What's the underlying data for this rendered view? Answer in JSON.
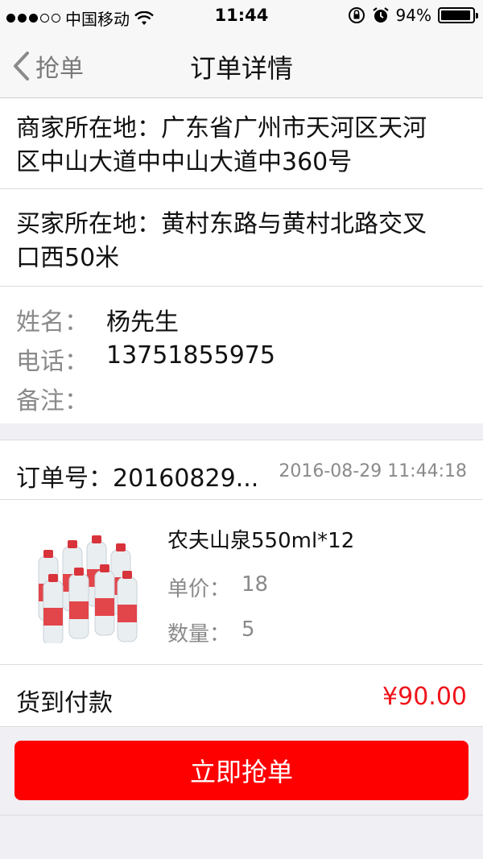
{
  "status_bar": {
    "carrier": "中国移动",
    "time": "11:44",
    "battery": "94%",
    "battery_level": 0.94
  },
  "nav": {
    "back_label": "抢单",
    "title": "订单详情"
  },
  "merchant": {
    "line1": "商家所在地：广东省广州市天河区天河",
    "line2": "区中山大道中中山大道中360号"
  },
  "buyer": {
    "line1": "买家所在地：黄村东路与黄村北路交叉",
    "line2": "口西50米"
  },
  "contact": {
    "name_label": "姓名：",
    "name_value": "杨先生",
    "phone_label": "电话：",
    "phone_value": "13751855975",
    "note_label": "备注：",
    "note_value": ""
  },
  "order": {
    "number": "订单号：20160829...",
    "time": "2016-08-29 11:44:18"
  },
  "product": {
    "name": "农夫山泉550ml*12",
    "price_label": "单价：",
    "price_value": "18",
    "qty_label": "数量：",
    "qty_value": "5"
  },
  "payment": {
    "method": "货到付款",
    "total": "¥90.00",
    "total_color": "#f0141b"
  },
  "action": {
    "grab_label": "立即抢单",
    "button_color": "#ff0000"
  },
  "icons": {
    "back": "chevron-left-icon",
    "wifi": "wifi-icon",
    "lock": "rotation-lock-icon",
    "alarm": "alarm-icon",
    "battery": "battery-icon",
    "product": "water-bottle-pack-image"
  }
}
